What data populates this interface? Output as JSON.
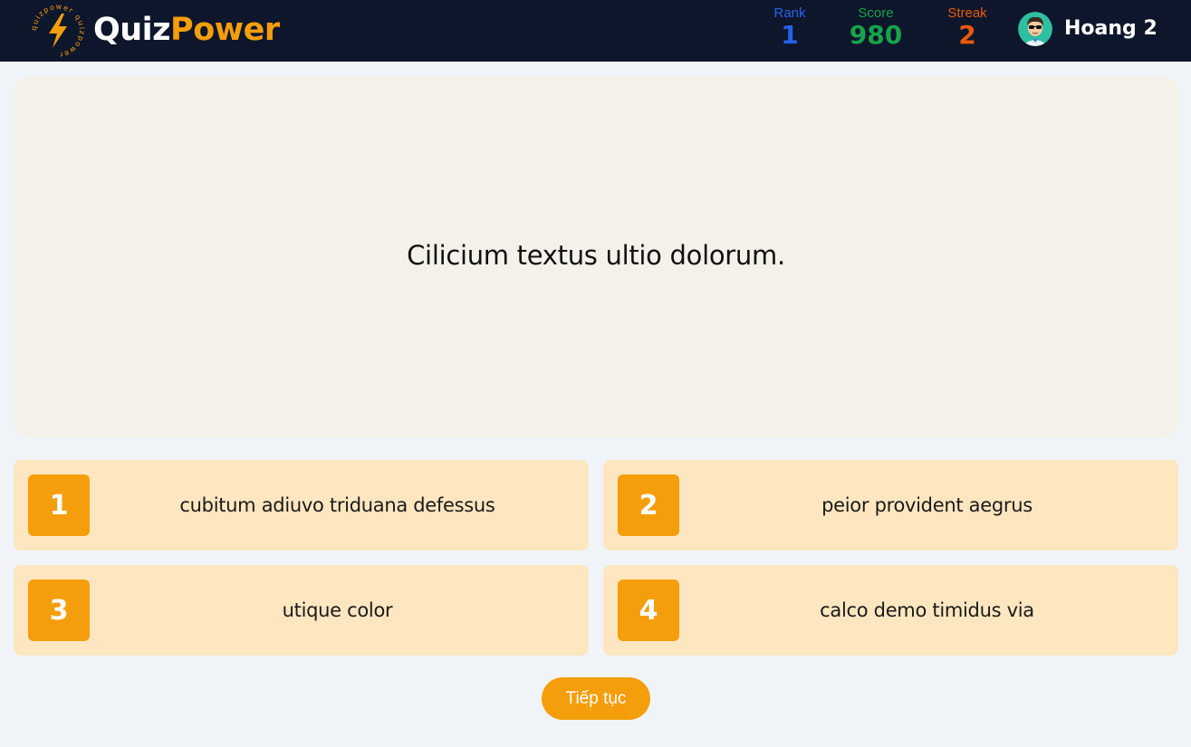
{
  "header": {
    "logo_ring_text": "quizpower quizpower",
    "brand_part1": "Quiz",
    "brand_part2": "Power",
    "stats": {
      "rank": {
        "label": "Rank",
        "value": "1",
        "color": "#2563eb"
      },
      "score": {
        "label": "Score",
        "value": "980",
        "color": "#16a34a"
      },
      "streak": {
        "label": "Streak",
        "value": "2",
        "color": "#ea580c"
      }
    },
    "user": {
      "name": "Hoang 2",
      "avatar_icon": "avatar-icon"
    }
  },
  "question": {
    "text": "Cilicium textus ultio dolorum."
  },
  "answers": [
    {
      "number": "1",
      "text": "cubitum adiuvo triduana defessus"
    },
    {
      "number": "2",
      "text": "peior provident aegrus"
    },
    {
      "number": "3",
      "text": "utique color"
    },
    {
      "number": "4",
      "text": "calco demo timidus via"
    }
  ],
  "continue_button": {
    "label": "Tiếp tục"
  },
  "colors": {
    "topbar": "#0e162b",
    "accent": "#f59e0b",
    "answer_bg": "#fde6c0",
    "question_bg": "#f4f1e9",
    "page_bg": "#f0f4f8"
  }
}
